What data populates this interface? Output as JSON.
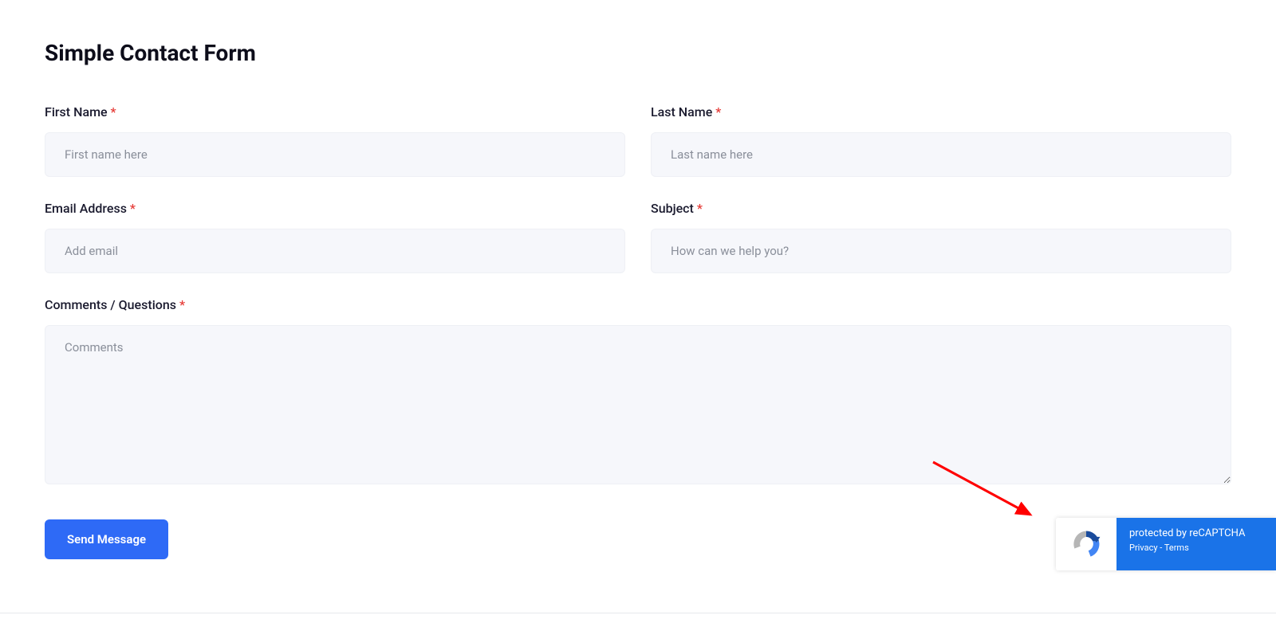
{
  "title": "Simple Contact Form",
  "required_mark": "*",
  "fields": {
    "first_name": {
      "label": "First Name ",
      "placeholder": "First name here",
      "value": ""
    },
    "last_name": {
      "label": "Last Name ",
      "placeholder": "Last name here",
      "value": ""
    },
    "email": {
      "label": "Email Address ",
      "placeholder": "Add email",
      "value": ""
    },
    "subject": {
      "label": "Subject ",
      "placeholder": "How can we help you?",
      "value": ""
    },
    "comments": {
      "label": "Comments / Questions ",
      "placeholder": "Comments",
      "value": ""
    }
  },
  "submit_label": "Send Message",
  "recaptcha": {
    "title": "protected by reCAPTCHA",
    "privacy": "Privacy",
    "sep": " - ",
    "terms": "Terms"
  }
}
